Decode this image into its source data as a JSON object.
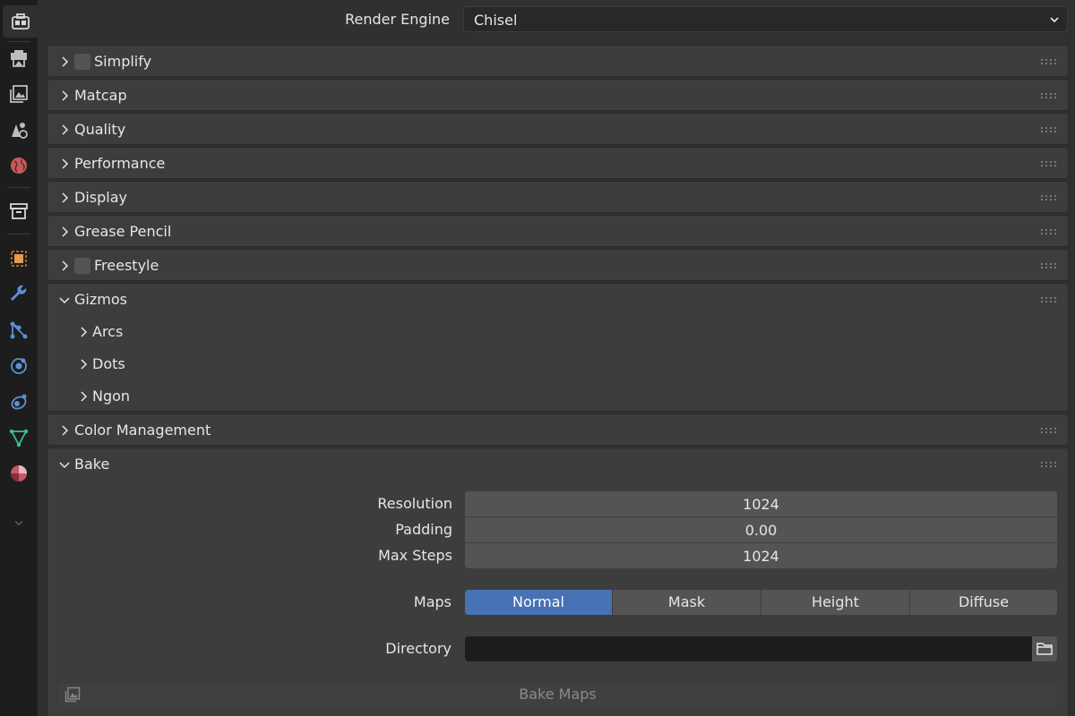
{
  "sidebar": {
    "tabs": [
      {
        "name": "tool-tab",
        "icon": "toolbox-icon",
        "active": true
      },
      {
        "name": "render-tab",
        "icon": "camera-back-icon",
        "active": false
      },
      {
        "name": "output-tab",
        "icon": "printer-icon",
        "active": false
      },
      {
        "name": "view-layer-tab",
        "icon": "image-stack-icon",
        "active": false
      },
      {
        "name": "scene-tab",
        "icon": "scene-shapes-icon",
        "active": false
      },
      {
        "name": "world-tab",
        "icon": "world-globe-icon",
        "active": false
      },
      {
        "name": "collection-tab",
        "icon": "box-archive-icon",
        "active": false
      },
      {
        "name": "object-tab",
        "icon": "object-square-icon",
        "active": false
      },
      {
        "name": "modifiers-tab",
        "icon": "wrench-icon",
        "active": false
      },
      {
        "name": "particles-tab",
        "icon": "particles-nodes-icon",
        "active": false
      },
      {
        "name": "physics-tab",
        "icon": "physics-orbit-icon",
        "active": false
      },
      {
        "name": "constraints-tab",
        "icon": "constraint-link-icon",
        "active": false
      },
      {
        "name": "data-tab",
        "icon": "mesh-triangle-icon",
        "active": false
      },
      {
        "name": "material-tab",
        "icon": "material-sphere-icon",
        "active": false
      }
    ],
    "collapse_icon": "chevron-down-icon"
  },
  "render_engine": {
    "label": "Render Engine",
    "value": "Chisel"
  },
  "panels": {
    "simplify": {
      "title": "Simplify",
      "expanded": false,
      "checkbox": false
    },
    "matcap": {
      "title": "Matcap",
      "expanded": false
    },
    "quality": {
      "title": "Quality",
      "expanded": false
    },
    "performance": {
      "title": "Performance",
      "expanded": false
    },
    "display": {
      "title": "Display",
      "expanded": false
    },
    "grease_pencil": {
      "title": "Grease Pencil",
      "expanded": false
    },
    "freestyle": {
      "title": "Freestyle",
      "expanded": false,
      "checkbox": false
    },
    "gizmos": {
      "title": "Gizmos",
      "expanded": true,
      "subpanels": [
        "Arcs",
        "Dots",
        "Ngon"
      ]
    },
    "color_management": {
      "title": "Color Management",
      "expanded": false
    },
    "bake": {
      "title": "Bake",
      "expanded": true,
      "resolution_label": "Resolution",
      "resolution_value": "1024",
      "padding_label": "Padding",
      "padding_value": "0.00",
      "max_steps_label": "Max Steps",
      "max_steps_value": "1024",
      "maps_label": "Maps",
      "maps_options": [
        "Normal",
        "Mask",
        "Height",
        "Diffuse"
      ],
      "maps_selected": "Normal",
      "directory_label": "Directory",
      "directory_value": "",
      "bake_button_label": "Bake Maps"
    }
  },
  "colors": {
    "accent": "#4772b3",
    "panel_bg": "#3d3d3d",
    "field_bg": "#545454",
    "sidebar_bg": "#1d1d1d"
  }
}
